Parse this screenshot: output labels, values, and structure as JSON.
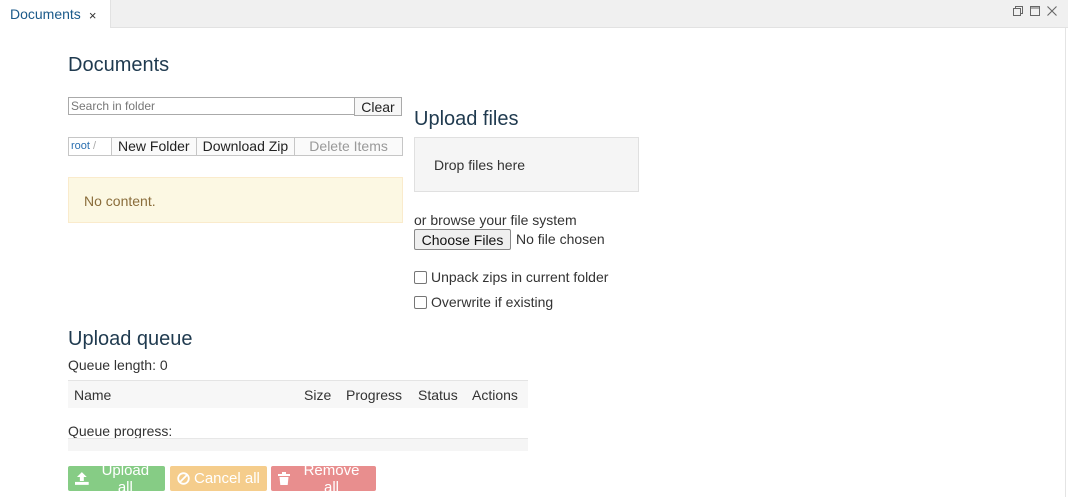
{
  "tab": {
    "label": "Documents",
    "close_glyph": "×"
  },
  "window_controls": [
    "restore-icon",
    "maximize-icon",
    "close-icon"
  ],
  "page_title": "Documents",
  "search": {
    "placeholder": "Search in folder",
    "value": "",
    "clear_label": "Clear"
  },
  "toolbar": {
    "breadcrumb_root": "root",
    "breadcrumb_sep": "/",
    "new_folder": "New Folder",
    "download_zip": "Download Zip",
    "delete_items": "Delete Items"
  },
  "empty_message": "No content.",
  "upload": {
    "title": "Upload files",
    "drop_text": "Drop files here",
    "browse_text": "or browse your file system",
    "choose_label": "Choose Files",
    "no_file": "No file chosen",
    "unpack_label": "Unpack zips in current folder",
    "overwrite_label": "Overwrite if existing"
  },
  "queue": {
    "title": "Upload queue",
    "length_text": "Queue length: 0",
    "columns": [
      "Name",
      "Size",
      "Progress",
      "Status",
      "Actions"
    ],
    "progress_label": "Queue progress:",
    "progress": 0
  },
  "actions": {
    "upload_all": "Upload all",
    "cancel_all": "Cancel all",
    "remove_all": "Remove all"
  },
  "colors": {
    "upload": "#86cc85",
    "cancel": "#f5cd8c",
    "remove": "#e88e8e",
    "empty_bg": "#fcf8e3",
    "empty_text": "#8a6d3b",
    "tab_text": "#1b5a8a"
  }
}
